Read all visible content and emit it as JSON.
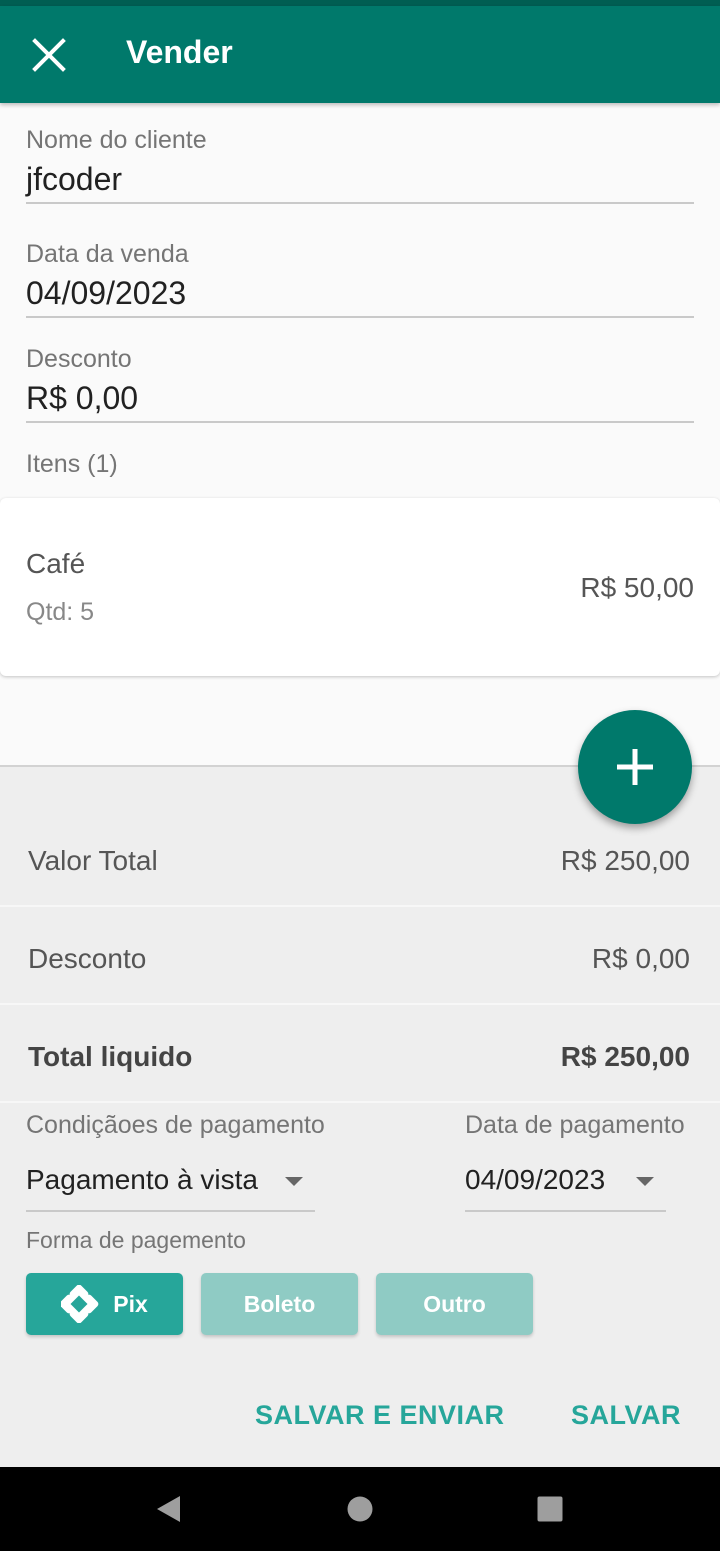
{
  "appbar": {
    "title": "Vender",
    "close_icon": "close-icon"
  },
  "form": {
    "customer": {
      "label": "Nome do cliente",
      "value": "jfcoder"
    },
    "sale_date": {
      "label": "Data da venda",
      "value": "04/09/2023"
    },
    "discount": {
      "label": "Desconto",
      "value": "R$ 0,00"
    }
  },
  "items": {
    "label": "Itens (1)",
    "list": [
      {
        "name": "Café",
        "qty": "Qtd: 5",
        "price": "R$ 50,00"
      }
    ]
  },
  "fab": {
    "icon": "add-icon"
  },
  "summary": {
    "total": {
      "label": "Valor Total",
      "value": "R$ 250,00"
    },
    "discount": {
      "label": "Desconto",
      "value": "R$ 0,00"
    },
    "net": {
      "label": "Total liquido",
      "value": "R$ 250,00"
    }
  },
  "payment": {
    "conditions_label": "Condiçãoes de pagamento",
    "conditions_value": "Pagamento à vista",
    "date_label": "Data de pagamento",
    "date_value": "04/09/2023",
    "method_label": "Forma de pagemento",
    "methods": [
      {
        "label": "Pix",
        "selected": true,
        "icon": "pix-icon"
      },
      {
        "label": "Boleto",
        "selected": false
      },
      {
        "label": "Outro",
        "selected": false
      }
    ]
  },
  "actions": {
    "save_send": "SALVAR E ENVIAR",
    "save": "SALVAR"
  },
  "colors": {
    "primary": "#00796b",
    "accent": "#26a69a",
    "accent_light": "#8fcbc4"
  },
  "navbar": {
    "back": "back-icon",
    "home": "home-icon",
    "recents": "recents-icon"
  }
}
